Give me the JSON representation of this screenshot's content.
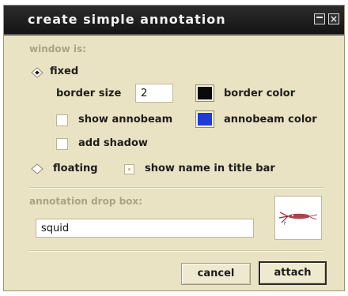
{
  "window": {
    "title": "create simple annotation",
    "controls": {
      "minimize": "minimize-icon",
      "close": "close-icon"
    }
  },
  "window_is": {
    "heading": "window is:",
    "fixed": {
      "label": "fixed",
      "selected": true,
      "border_size_label": "border size",
      "border_size_value": "2",
      "border_color_label": "border color",
      "border_color": "#0a0a0a",
      "show_annobeam_label": "show annobeam",
      "show_annobeam_checked": false,
      "annobeam_color_label": "annobeam color",
      "annobeam_color": "#1f3bd6",
      "add_shadow_label": "add shadow",
      "add_shadow_checked": false
    },
    "floating": {
      "label": "floating",
      "selected": false,
      "show_name_label": "show name in title bar",
      "show_name_checked": false
    }
  },
  "drop_box": {
    "heading": "annotation drop box:",
    "value": "squid",
    "thumbnail_icon": "squid-thumbnail-icon"
  },
  "buttons": {
    "cancel": "cancel",
    "attach": "attach"
  },
  "colors": {
    "dialog_bg": "#e9e3c4",
    "titlebar_bg": "#1d1d1d",
    "section_heading": "#a9a385"
  }
}
